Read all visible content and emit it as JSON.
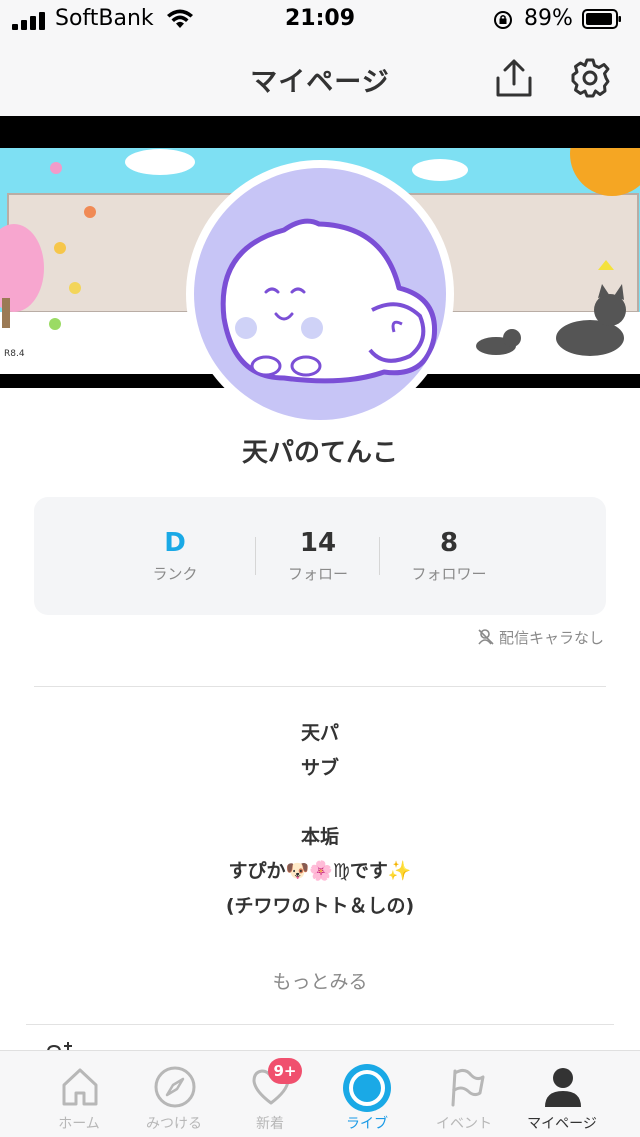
{
  "status_bar": {
    "carrier": "SoftBank",
    "time": "21:09",
    "battery": "89%"
  },
  "header": {
    "title": "マイページ",
    "share_icon": "share-icon",
    "settings_icon": "gear-icon"
  },
  "profile": {
    "username": "天パのてんこ",
    "stats": {
      "rank_value": "D",
      "rank_label": "ランク",
      "follow_value": "14",
      "follow_label": "フォロー",
      "follower_value": "8",
      "follower_label": "フォロワー"
    },
    "no_character": "配信キャラなし",
    "bio_lines": [
      "天パ",
      "サブ",
      "",
      "本垢",
      "すぴか🐶🌸♍です✨",
      "(チワワのトト＆しの)"
    ],
    "more": "もっとみる"
  },
  "tabs": [
    {
      "label": "ホーム",
      "icon": "home-icon"
    },
    {
      "label": "みつける",
      "icon": "compass-icon"
    },
    {
      "label": "新着",
      "icon": "heart-icon",
      "badge": "9+"
    },
    {
      "label": "ライブ",
      "icon": "live-circle-icon"
    },
    {
      "label": "イベント",
      "icon": "flag-icon"
    },
    {
      "label": "マイページ",
      "icon": "person-icon"
    }
  ],
  "colors": {
    "accent": "#1aa9e6",
    "badge": "#f0506e",
    "avatar_bg": "#c7c5f6"
  }
}
